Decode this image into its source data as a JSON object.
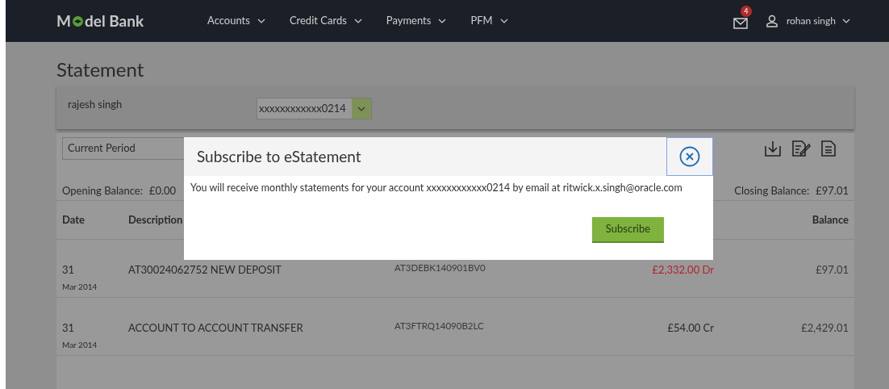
{
  "navbar": {
    "logo_start": "M",
    "logo_end": "del Bank",
    "menu": [
      {
        "label": "Accounts"
      },
      {
        "label": "Credit Cards"
      },
      {
        "label": "Payments"
      },
      {
        "label": "PFM"
      }
    ],
    "mail_badge": "4",
    "user": "rohan singh"
  },
  "page": {
    "title": "Statement",
    "account_holder": "rajesh singh",
    "account_select": "xxxxxxxxxxxx0214",
    "period_select": "Current Period",
    "opening_balance_label": "Opening Balance:",
    "opening_balance": "£0.00",
    "closing_balance_label": "Closing Balance:",
    "closing_balance": "£97.01"
  },
  "table": {
    "columns": [
      {
        "label": "Date"
      },
      {
        "label": "Description"
      },
      {
        "label": "Balance"
      }
    ],
    "rows": [
      {
        "day": "31",
        "month": "Mar 2014",
        "description": "AT30024062752 NEW DEPOSIT",
        "reference": "AT3DEBK140901BV0",
        "amount": "£2,332.00 Dr",
        "kind": "debit",
        "balance": "£97.01"
      },
      {
        "day": "31",
        "month": "Mar 2014",
        "description": "ACCOUNT TO ACCOUNT TRANSFER",
        "reference": "AT3FTRQ14090B2LC",
        "amount": "£54.00 Cr",
        "kind": "credit",
        "balance": "£2,429.01"
      }
    ]
  },
  "dialog": {
    "title": "Subscribe to eStatement",
    "message": "You will receive monthly statements for your account xxxxxxxxxxxx0214 by email at ritwick.x.singh@oracle.com",
    "button": "Subscribe"
  }
}
